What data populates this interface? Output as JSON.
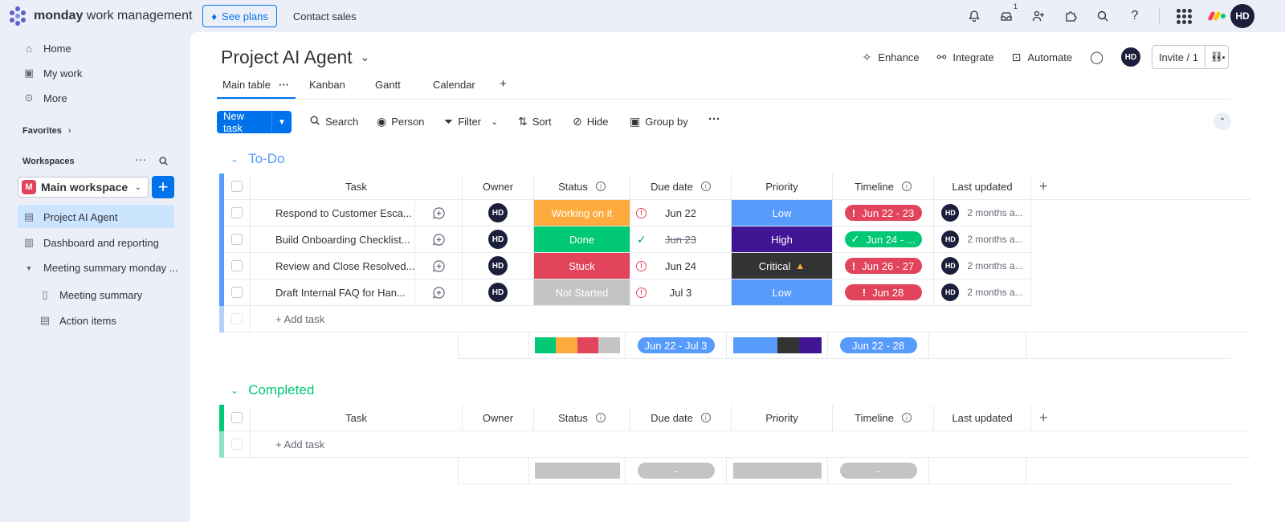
{
  "topbar": {
    "brand_bold": "monday",
    "brand_rest": " work management",
    "see_plans": "See plans",
    "contact_sales": "Contact sales",
    "inbox_badge": "1",
    "avatar": "HD"
  },
  "sidebar": {
    "home": "Home",
    "my_work": "My work",
    "more": "More",
    "favorites": "Favorites",
    "workspaces": "Workspaces",
    "workspace_badge": "M",
    "workspace_name": "Main workspace",
    "items": [
      {
        "label": "Project AI Agent"
      },
      {
        "label": "Dashboard and reporting"
      },
      {
        "label": "Meeting summary monday ..."
      },
      {
        "label": "Meeting summary"
      },
      {
        "label": "Action items"
      }
    ]
  },
  "board": {
    "title": "Project AI Agent",
    "actions": {
      "enhance": "Enhance",
      "integrate": "Integrate",
      "automate": "Automate",
      "avatar": "HD",
      "invite": "Invite / 1"
    },
    "tabs": [
      "Main table",
      "Kanban",
      "Gantt",
      "Calendar",
      "+"
    ],
    "toolbar": {
      "new_task": "New task",
      "search": "Search",
      "person": "Person",
      "filter": "Filter",
      "sort": "Sort",
      "hide": "Hide",
      "group_by": "Group by"
    },
    "columns": [
      "Task",
      "Owner",
      "Status",
      "Due date",
      "Priority",
      "Timeline",
      "Last updated"
    ],
    "groups": [
      {
        "title": "To-Do",
        "color": "#579bfc",
        "add_task": "+ Add task",
        "rows": [
          {
            "task": "Respond to Customer Esca...",
            "owner": "HD",
            "status": "Working on it",
            "status_color": "#fdab3d",
            "due": "Jun 22",
            "due_state": "overdue",
            "priority": "Low",
            "priority_color": "#579bfc",
            "timeline": "Jun 22 - 23",
            "timeline_color": "#e2445c",
            "timeline_mark": "!",
            "updated": "2 months a..."
          },
          {
            "task": "Build Onboarding Checklist...",
            "owner": "HD",
            "status": "Done",
            "status_color": "#00c875",
            "due": "Jun 23",
            "due_state": "done",
            "priority": "High",
            "priority_color": "#401694",
            "timeline": "Jun 24 - ...",
            "timeline_color": "#00c875",
            "timeline_mark": "✓",
            "updated": "2 months a..."
          },
          {
            "task": "Review and Close Resolved...",
            "owner": "HD",
            "status": "Stuck",
            "status_color": "#e2445c",
            "due": "Jun 24",
            "due_state": "overdue",
            "priority": "Critical",
            "priority_color": "#333333",
            "timeline": "Jun 26 - 27",
            "timeline_color": "#e2445c",
            "timeline_mark": "!",
            "updated": "2 months a..."
          },
          {
            "task": "Draft Internal FAQ for Han...",
            "owner": "HD",
            "status": "Not Started",
            "status_color": "#c4c4c4",
            "due": "Jul 3",
            "due_state": "overdue",
            "priority": "Low",
            "priority_color": "#579bfc",
            "timeline": "Jun 28",
            "timeline_color": "#e2445c",
            "timeline_mark": "!",
            "updated": "2 months a..."
          }
        ],
        "summary": {
          "status_segments": [
            {
              "color": "#00c875",
              "fraction": 0.25
            },
            {
              "color": "#fdab3d",
              "fraction": 0.25
            },
            {
              "color": "#e2445c",
              "fraction": 0.25
            },
            {
              "color": "#c4c4c4",
              "fraction": 0.25
            }
          ],
          "due": "Jun 22 - Jul 3",
          "priority_segments": [
            {
              "color": "#579bfc",
              "fraction": 0.5
            },
            {
              "color": "#333333",
              "fraction": 0.25
            },
            {
              "color": "#401694",
              "fraction": 0.25
            }
          ],
          "timeline": "Jun 22 - 28"
        }
      },
      {
        "title": "Completed",
        "color": "#00c875",
        "add_task": "+ Add task",
        "rows": [],
        "summary": {
          "due": "-",
          "timeline": "-"
        }
      }
    ]
  }
}
